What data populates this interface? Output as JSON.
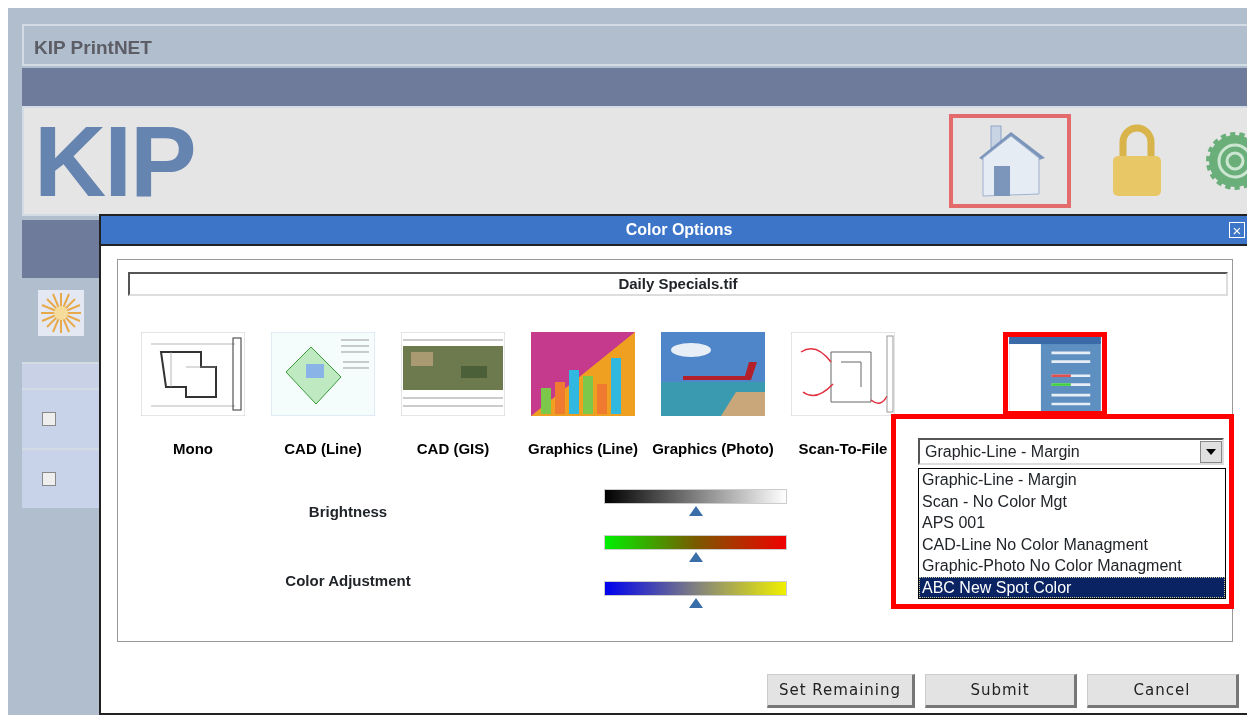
{
  "app": {
    "title": "KIP PrintNET",
    "logo": "KIP"
  },
  "sidebar": {
    "rows": [
      {
        "checked": false
      },
      {
        "checked": false
      }
    ]
  },
  "dialog": {
    "title": "Color Options",
    "close": "×",
    "filename": "Daily Specials.tif",
    "presets": [
      {
        "label": "Mono",
        "kind": "plan",
        "selected": false
      },
      {
        "label": "CAD (Line)",
        "kind": "site",
        "selected": false
      },
      {
        "label": "CAD (GIS)",
        "kind": "map",
        "selected": false
      },
      {
        "label": "Graphics (Line)",
        "kind": "chart",
        "selected": false
      },
      {
        "label": "Graphics (Photo)",
        "kind": "photo",
        "selected": false
      },
      {
        "label": "Scan-To-File",
        "kind": "scan",
        "selected": false
      },
      {
        "kind": "settings",
        "selected": true
      }
    ],
    "dropdown": {
      "value": "Graphic-Line - Margin",
      "options": [
        {
          "label": "Graphic-Line - Margin",
          "highlighted": false
        },
        {
          "label": "Scan - No Color Mgt",
          "highlighted": false
        },
        {
          "label": "APS 001",
          "highlighted": false
        },
        {
          "label": "CAD-Line No Color Managment",
          "highlighted": false
        },
        {
          "label": "Graphic-Photo No Color Managment",
          "highlighted": false
        },
        {
          "label": "ABC New Spot Color",
          "highlighted": true
        }
      ]
    },
    "adjustments": [
      {
        "label": "Brightness",
        "sliders": [
          {
            "kind": "brightness",
            "level": 0.5
          }
        ]
      },
      {
        "label": "Color Adjustment",
        "sliders": [
          {
            "kind": "green-red",
            "level": 0.5
          },
          {
            "kind": "blue-yellow",
            "level": 0.5
          }
        ]
      }
    ],
    "buttons": [
      "Set Remaining",
      "Submit",
      "Cancel"
    ]
  }
}
